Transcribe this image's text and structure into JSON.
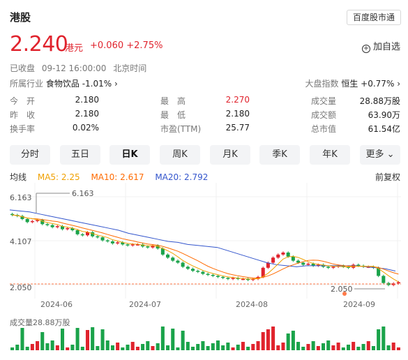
{
  "header": {
    "market": "港股",
    "source_button": "百度股市通"
  },
  "quote": {
    "price": "2.240",
    "currency": "港元",
    "change": "+0.060",
    "change_pct": "+2.75%",
    "watch_label": "加自选",
    "watch_icon": "plus-circle-icon"
  },
  "status": {
    "state": "已收盘",
    "datetime": "09-12 16:00:00",
    "timezone": "北京时间"
  },
  "industry": {
    "label": "所属行业",
    "name": "食物饮品",
    "pct": "-1.01%",
    "index_label": "大盘指数",
    "index_name": "恒生",
    "index_pct": "+0.77%"
  },
  "stats": {
    "open": {
      "k": "今　开",
      "v": "2.180"
    },
    "high": {
      "k": "最　高",
      "v": "2.270"
    },
    "volume": {
      "k": "成交量",
      "v": "28.88万股"
    },
    "prev_close": {
      "k": "昨　收",
      "v": "2.180"
    },
    "low": {
      "k": "最　低",
      "v": "2.180"
    },
    "turnover": {
      "k": "成交额",
      "v": "63.90万"
    },
    "turnover_rate": {
      "k": "换手率",
      "v": "0.02%"
    },
    "pe": {
      "k": "市盈(TTM)",
      "v": "25.77"
    },
    "market_cap": {
      "k": "总市值",
      "v": "61.54亿"
    }
  },
  "tabs": [
    "分时",
    "五日",
    "日K",
    "周K",
    "月K",
    "季K",
    "年K",
    "更多"
  ],
  "active_tab": "日K",
  "ma": {
    "label": "均线",
    "ma5": "MA5: 2.25",
    "ma10": "MA10: 2.617",
    "ma20": "MA20: 2.792",
    "adjust": "前复权"
  },
  "colors": {
    "up": "#e0232d",
    "down": "#1aa34a",
    "ma5": "#f0a000",
    "ma10": "#ff6a00",
    "ma20": "#3355cc"
  },
  "chart_data": {
    "type": "candlestick",
    "y_ticks": [
      "6.163",
      "4.107",
      "2.050"
    ],
    "x_ticks": [
      "2024-06",
      "2024-07",
      "2024-08",
      "2024-09"
    ],
    "max_label": "6.163",
    "min_label": "2.050",
    "ylim": [
      2.05,
      6.163
    ],
    "closes": [
      5.55,
      5.5,
      5.35,
      5.2,
      5.25,
      5.3,
      5.1,
      5.05,
      4.95,
      5.0,
      4.85,
      4.9,
      4.8,
      4.6,
      4.55,
      4.7,
      4.5,
      4.45,
      4.3,
      4.25,
      4.15,
      4.2,
      4.1,
      4.05,
      4.1,
      4.1,
      4.0,
      3.95,
      4.05,
      3.9,
      3.6,
      3.45,
      3.3,
      3.2,
      3.0,
      2.9,
      2.8,
      2.75,
      2.65,
      2.6,
      2.55,
      2.5,
      2.45,
      2.4,
      2.45,
      2.4,
      2.4,
      2.35,
      2.4,
      2.5,
      2.95,
      3.2,
      3.45,
      3.6,
      3.7,
      3.5,
      3.3,
      3.2,
      3.1,
      3.15,
      3.05,
      3.1,
      3.0,
      2.95,
      3.0,
      3.05,
      3.0,
      2.95,
      3.1,
      3.05,
      3.0,
      3.0,
      2.95,
      2.55,
      2.2,
      2.1,
      2.18,
      2.24
    ],
    "ma20": [
      5.8,
      5.75,
      5.7,
      5.6,
      5.5,
      5.4,
      5.3,
      5.2,
      5.1,
      5.0,
      4.9,
      4.8,
      4.65,
      4.55,
      4.45,
      4.35,
      4.25,
      4.2,
      4.1,
      4.05,
      4.0,
      3.95,
      3.8,
      3.65,
      3.5,
      3.35,
      3.2,
      3.1,
      3.05,
      3.0,
      3.05,
      3.05,
      3.05,
      3.05,
      3.05,
      3.05,
      3.0,
      2.95,
      2.9,
      2.79
    ],
    "volume_label": "成交量28.88万股"
  }
}
